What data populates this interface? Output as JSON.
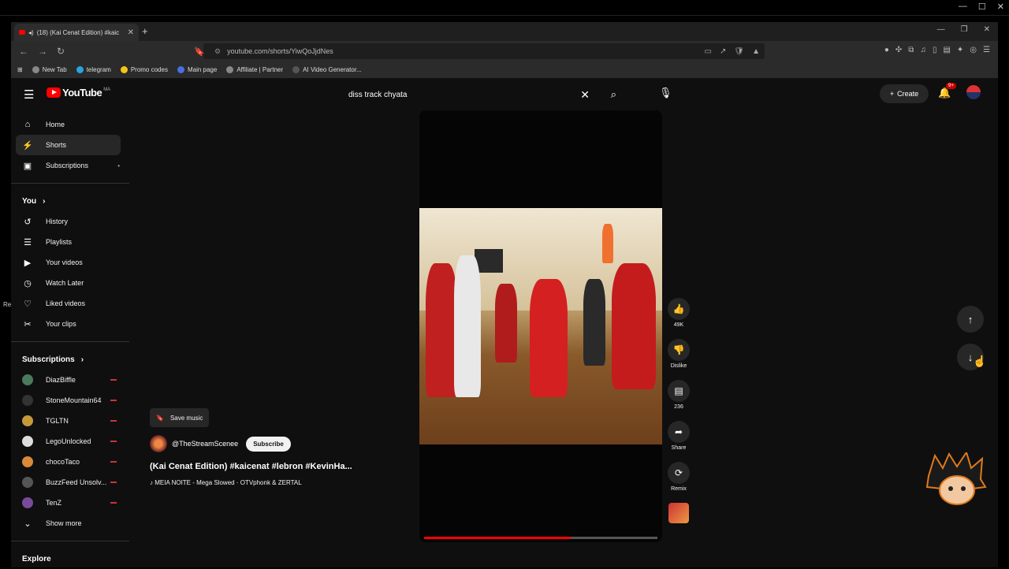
{
  "browser": {
    "tab_title": "(18) (Kai Cenat Edition) #kaic",
    "url": "youtube.com/shorts/YiwQoJjdNes",
    "bookmarks": [
      {
        "label": "New Tab",
        "color": "#888888"
      },
      {
        "label": "telegram",
        "color": "#2aa3e0"
      },
      {
        "label": "Promo codes",
        "color": "#f5c518"
      },
      {
        "label": "Main page",
        "color": "#4a6ee0"
      },
      {
        "label": "Affiliate | Partner",
        "color": "#888888"
      },
      {
        "label": "AI Video Generator...",
        "color": "#555555"
      }
    ]
  },
  "masthead": {
    "logo_text": "YouTube",
    "country_code": "MA",
    "search_value": "diss track chyata",
    "create_label": "Create",
    "notification_count": "9+"
  },
  "sidebar": {
    "main": [
      {
        "label": "Home",
        "icon": "home-icon",
        "glyph": "⌂"
      },
      {
        "label": "Shorts",
        "icon": "shorts-icon",
        "glyph": "⚡"
      },
      {
        "label": "Subscriptions",
        "icon": "subscriptions-icon",
        "glyph": "▣"
      }
    ],
    "you_heading": "You",
    "you": [
      {
        "label": "History",
        "icon": "history-icon",
        "glyph": "↺"
      },
      {
        "label": "Playlists",
        "icon": "playlists-icon",
        "glyph": "☰"
      },
      {
        "label": "Your videos",
        "icon": "your-videos-icon",
        "glyph": "▶"
      },
      {
        "label": "Watch Later",
        "icon": "watch-later-icon",
        "glyph": "◷"
      },
      {
        "label": "Liked videos",
        "icon": "liked-videos-icon",
        "glyph": "👍"
      },
      {
        "label": "Your clips",
        "icon": "clips-icon",
        "glyph": "✂"
      }
    ],
    "subscriptions_heading": "Subscriptions",
    "subscriptions": [
      {
        "label": "DiazBiffle",
        "color": "#4a7a5a"
      },
      {
        "label": "StoneMountain64",
        "color": "#333333"
      },
      {
        "label": "TGLTN",
        "color": "#c59a3a"
      },
      {
        "label": "LegoUnlocked",
        "color": "#dddddd"
      },
      {
        "label": "chocoTaco",
        "color": "#d98a3a"
      },
      {
        "label": "BuzzFeed Unsolv...",
        "color": "#555555"
      },
      {
        "label": "TenZ",
        "color": "#7a4a9a"
      }
    ],
    "show_more": "Show more",
    "explore": "Explore"
  },
  "short": {
    "save_music": "Save music",
    "channel": "@TheStreamSceneе",
    "subscribe": "Subscribe",
    "title": "(Kai Cenat Edition) #kaicenat #lebron #KevinHa...",
    "music": "MEIA NOITE - Mega Slowed · OTVphonk & ZERTAL",
    "progress": 0.63
  },
  "actions": {
    "likes": "49K",
    "dislike": "Dislike",
    "comments": "236",
    "share": "Share",
    "remix": "Remix"
  },
  "side_edge_text": "Re"
}
